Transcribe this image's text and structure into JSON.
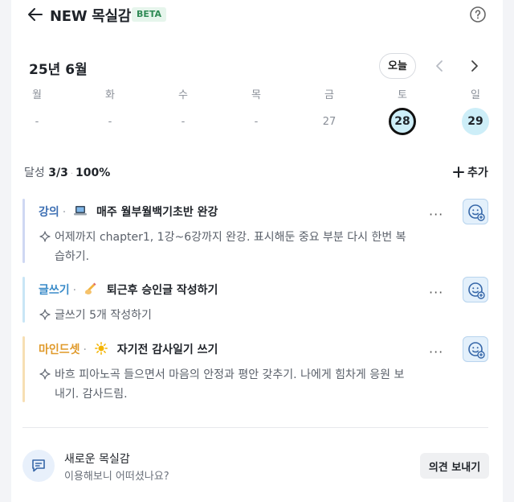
{
  "header": {
    "title": "NEW 목실감",
    "badge": "BETA"
  },
  "calendar": {
    "month_label": "25년 6월",
    "today_label": "오늘",
    "weekdays": [
      "월",
      "화",
      "수",
      "목",
      "금",
      "토",
      "일"
    ],
    "days": [
      "-",
      "-",
      "-",
      "-",
      "27",
      "28",
      "29"
    ],
    "selected_day": "28",
    "highlight_color": "#cdeef8"
  },
  "progress": {
    "label": "달성",
    "count": "3/3",
    "percent": "100%",
    "add_label": "추가"
  },
  "tasks": [
    {
      "category": "강의",
      "category_color": "#3d6fb3",
      "bar_color": "#cfd8f3",
      "emoji_icon": "laptop-icon",
      "title": "매주 월부월백기초반 완강",
      "description": "어제까지 chapter1, 1강~6강까지 완강. 표시해둔 중요 부분 다시 한번 복습하기."
    },
    {
      "category": "글쓰기",
      "category_color": "#3b8cc9",
      "bar_color": "#c9e6f6",
      "emoji_icon": "writing-hand-icon",
      "title": "퇴근후 승인글 작성하기",
      "description": "글쓰기 5개 작성하기"
    },
    {
      "category": "마인드셋",
      "category_color": "#e09a2b",
      "bar_color": "#f7dfb3",
      "emoji_icon": "sun-icon",
      "title": "자기전 감사일기 쓰기",
      "description": "바흐 피아노곡 들으면서 마음의 안정과 평안 갖추기. 나에게 힘차게 응원 보내기. 감사드림."
    }
  ],
  "feedback": {
    "title": "새로운 목실감",
    "subtitle": "이용해보니 어떠셨나요?",
    "button_label": "의견 보내기"
  }
}
